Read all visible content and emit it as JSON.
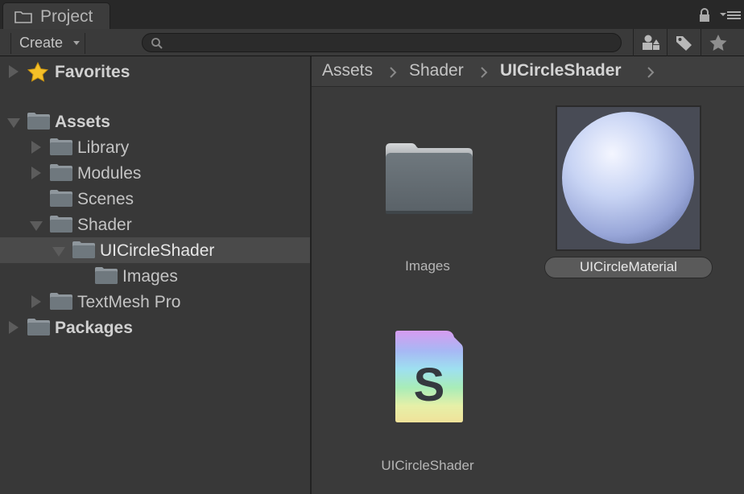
{
  "window": {
    "tab_title": "Project",
    "icons": [
      "folder-icon",
      "lock-icon",
      "menu-icon"
    ]
  },
  "toolbar": {
    "create_label": "Create",
    "search_placeholder": "",
    "search_value": "",
    "buttons": [
      "filter-by-type-icon",
      "filter-by-label-icon",
      "favorite-star-icon"
    ]
  },
  "tree": {
    "favorites": "Favorites",
    "assets": "Assets",
    "library": "Library",
    "modules": "Modules",
    "scenes": "Scenes",
    "shader": "Shader",
    "uicircleshader": "UICircleShader",
    "images": "Images",
    "textmeshpro": "TextMesh Pro",
    "packages": "Packages"
  },
  "breadcrumb": [
    "Assets",
    "Shader",
    "UICircleShader"
  ],
  "assets": {
    "folder_images": "Images",
    "material": "UICircleMaterial",
    "shader": "UICircleShader"
  },
  "colors": {
    "background": "#383838",
    "selection": "#4a4a4a",
    "sphere": "#c8d4f4"
  }
}
